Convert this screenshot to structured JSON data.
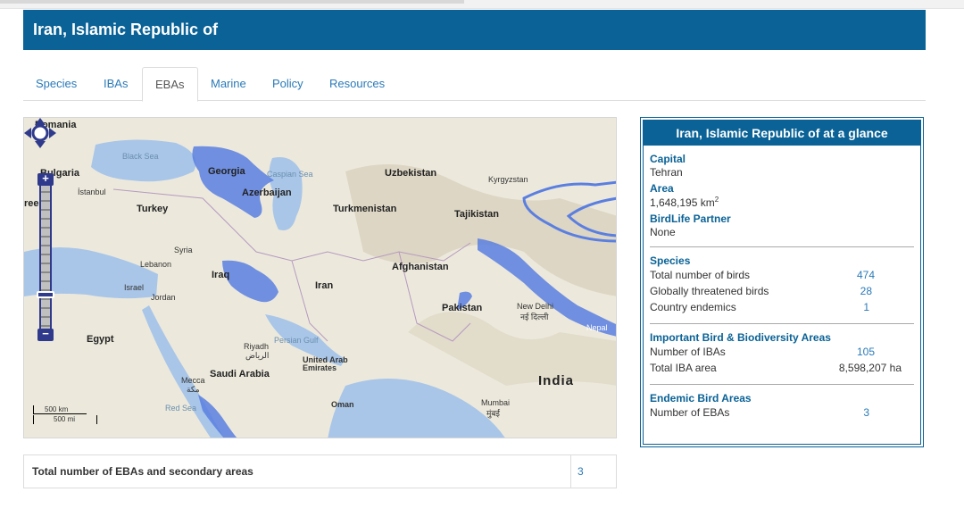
{
  "country": {
    "title": "Iran, Islamic Republic of"
  },
  "tabs": [
    {
      "label": "Species"
    },
    {
      "label": "IBAs"
    },
    {
      "label": "EBAs",
      "active": true
    },
    {
      "label": "Marine"
    },
    {
      "label": "Policy"
    },
    {
      "label": "Resources"
    }
  ],
  "map": {
    "labels": {
      "romania": "Romania",
      "bulgaria": "Bulgaria",
      "istanbul": "İstanbul",
      "greece": "reece",
      "black_sea": "Black Sea",
      "georgia": "Georgia",
      "caspian": "Caspian Sea",
      "azerbaijan": "Azerbaijan",
      "turkey": "Turkey",
      "uzbekistan": "Uzbekistan",
      "kyrgyzstan": "Kyrgyzstan",
      "turkmenistan": "Turkmenistan",
      "tajikistan": "Tajikistan",
      "syria": "Syria",
      "lebanon": "Lebanon",
      "israel": "Israel",
      "jordan": "Jordan",
      "iraq": "Iraq",
      "iran": "Iran",
      "afghanistan": "Afghanistan",
      "pakistan": "Pakistan",
      "new_delhi": "New Delhi",
      "new_delhi_hi": "नई दिल्ली",
      "nepal": "Nepal",
      "egypt": "Egypt",
      "riyadh": "Riyadh",
      "riyadh_ar": "الرياض",
      "persian_gulf": "Persian Gulf",
      "uae": "United Arab\nEmirates",
      "saudi": "Saudi Arabia",
      "mecca": "Mecca",
      "mecca_ar": "مكة",
      "india": "India",
      "red_sea": "Red Sea",
      "oman": "Oman",
      "mumbai": "Mumbai",
      "mumbai_hi": "मुंबई"
    },
    "scale": {
      "km": "500 km",
      "mi": "500 mi"
    },
    "colors": {
      "eba_fill": "#5b7fe0",
      "water": "#a9c6e8",
      "land": "#ece9dc"
    }
  },
  "glance": {
    "title": "Iran, Islamic Republic of at a glance",
    "capital_label": "Capital",
    "capital": "Tehran",
    "area_label": "Area",
    "area": "1,648,195 km",
    "area_sup": "2",
    "partner_label": "BirdLife Partner",
    "partner": "None",
    "species_label": "Species",
    "species": [
      {
        "k": "Total number of birds",
        "v": "474"
      },
      {
        "k": "Globally threatened birds",
        "v": "28"
      },
      {
        "k": "Country endemics",
        "v": "1"
      }
    ],
    "iba_label": "Important Bird & Biodiversity Areas",
    "iba": [
      {
        "k": "Number of IBAs",
        "v": "105"
      },
      {
        "k": "Total IBA area",
        "v": "8,598,207 ha"
      }
    ],
    "eba_label": "Endemic Bird Areas",
    "eba": [
      {
        "k": "Number of EBAs",
        "v": "3"
      }
    ]
  },
  "total": {
    "label": "Total number of EBAs and secondary areas",
    "value": "3"
  },
  "colors": {
    "header": "#0a6296",
    "link": "#2a7ab8"
  }
}
